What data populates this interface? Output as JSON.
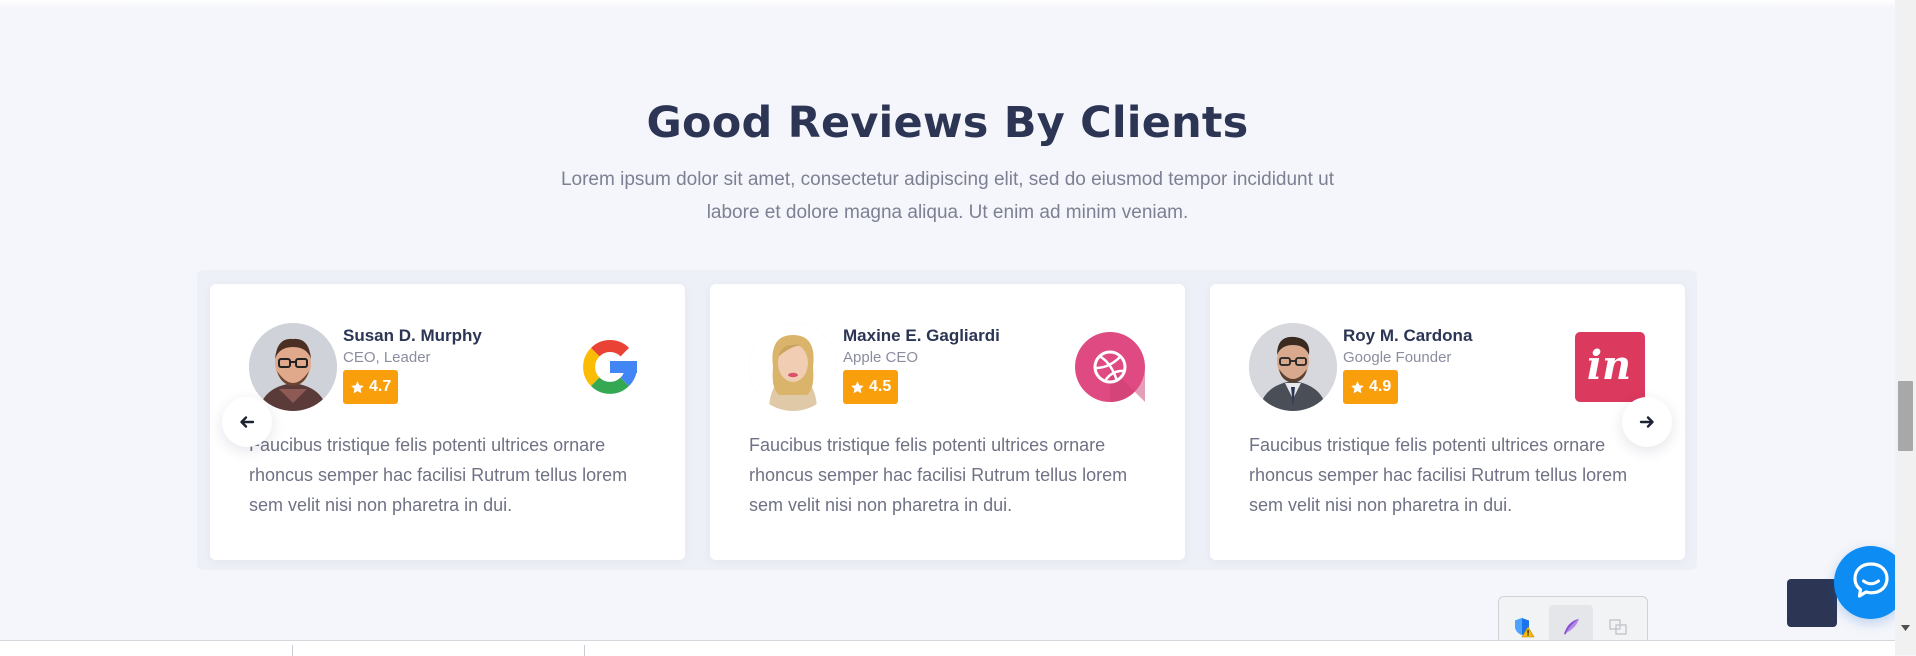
{
  "section": {
    "title": "Good Reviews By Clients",
    "subtitle": "Lorem ipsum dolor sit amet, consectetur adipiscing elit, sed do eiusmod tempor incididunt ut labore et dolore magna aliqua. Ut enim ad minim veniam."
  },
  "reviews": [
    {
      "name": "Susan D. Murphy",
      "role": "CEO, Leader",
      "rating": "4.7",
      "brand_icon": "google-logo-icon",
      "text": "Faucibus tristique felis potenti ultrices ornare rhoncus semper hac facilisi Rutrum tellus lorem sem velit nisi non pharetra in dui."
    },
    {
      "name": "Maxine E. Gagliardi",
      "role": "Apple CEO",
      "rating": "4.5",
      "brand_icon": "dribbble-logo-icon",
      "text": "Faucibus tristique felis potenti ultrices ornare rhoncus semper hac facilisi Rutrum tellus lorem sem velit nisi non pharetra in dui."
    },
    {
      "name": "Roy M. Cardona",
      "role": "Google Founder",
      "rating": "4.9",
      "brand_icon": "invision-logo-icon",
      "text": "Faucibus tristique felis potenti ultrices ornare rhoncus semper hac facilisi Rutrum tellus lorem sem velit nisi non pharetra in dui."
    }
  ],
  "brands": {
    "invision_mark": "in"
  },
  "carousel": {
    "prev_icon": "arrow-left-icon",
    "next_icon": "arrow-right-icon"
  },
  "colors": {
    "heading": "#2c3654",
    "rating_badge": "#f99f0c",
    "chat_button": "#0d8cf3",
    "dribbble": "#e04a82",
    "invision": "#dc395f"
  },
  "tray": {
    "icons": [
      "shield-warning-icon",
      "feather-icon",
      "translate-icon"
    ]
  },
  "chat": {
    "icon": "chat-bubble-icon"
  }
}
